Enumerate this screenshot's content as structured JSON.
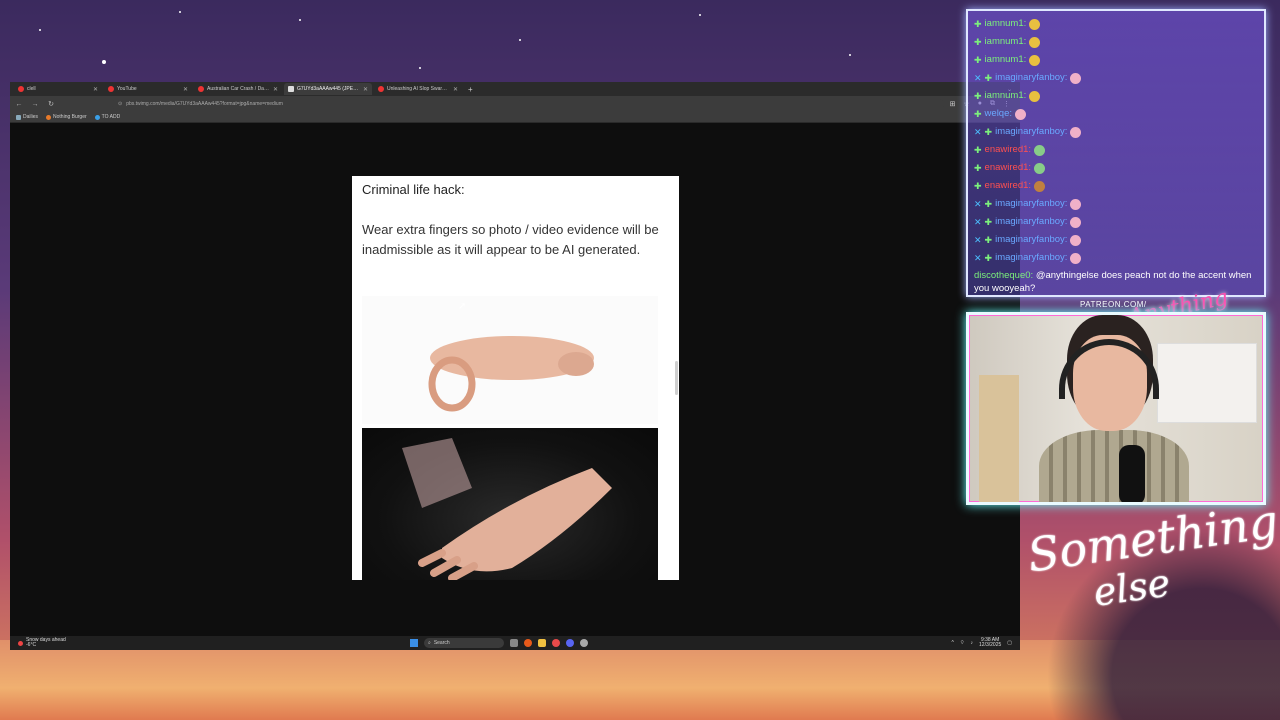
{
  "browser": {
    "tabs": [
      {
        "label": "clell",
        "active": false
      },
      {
        "label": "YouTube",
        "active": false
      },
      {
        "label": "Australian Car Crash / Dash Ca",
        "active": false
      },
      {
        "label": "G7UYd3aAAAw445 (JPEG Image",
        "active": true
      },
      {
        "label": "Unleashing AI Slop Swarms - Y",
        "active": false
      }
    ],
    "new_tab": "+",
    "tab_dropdown": "⌄",
    "url": "pbs.twimg.com/media/G7UYd3aAAAw445?format=jpg&name=medium",
    "bookmarks": [
      {
        "label": "Dailies",
        "icon": "folder-icon"
      },
      {
        "label": "Nothing Burger",
        "icon": "burger-icon"
      },
      {
        "label": "TO ADD",
        "icon": "globe-icon"
      }
    ]
  },
  "image": {
    "title": "Criminal life hack:",
    "body": "Wear extra fingers so photo / video evidence will be inadmissible as it will appear to be AI generated."
  },
  "taskbar": {
    "weather_line1": "Snow days ahead",
    "weather_line2": "-6°C",
    "search_label": "Search",
    "time": "9:38 AM",
    "date": "12/3/2025"
  },
  "chat": {
    "messages": [
      {
        "user": "iamnum1:",
        "color": "#7cf07c",
        "badges": 1,
        "emote": "#e8c040"
      },
      {
        "user": "iamnum1:",
        "color": "#7cf07c",
        "badges": 1,
        "emote": "#e8c040"
      },
      {
        "user": "iamnum1:",
        "color": "#7cf07c",
        "badges": 1,
        "emote": "#e8c040"
      },
      {
        "user": "imaginaryfanboy:",
        "color": "#6aa8ff",
        "badges": 2,
        "emote": "#f0b0c8"
      },
      {
        "user": "iamnum1:",
        "color": "#7cf07c",
        "badges": 1,
        "emote": "#e8c040"
      },
      {
        "user": "welqe:",
        "color": "#6aa8ff",
        "badges": 1,
        "emote": "#f0b0c8"
      },
      {
        "user": "imaginaryfanboy:",
        "color": "#6aa8ff",
        "badges": 2,
        "emote": "#f0b0c8"
      },
      {
        "user": "enawired1:",
        "color": "#ff5050",
        "badges": 1,
        "emote": "#88cc88"
      },
      {
        "user": "enawired1:",
        "color": "#ff5050",
        "badges": 1,
        "emote": "#88cc88"
      },
      {
        "user": "enawired1:",
        "color": "#ff5050",
        "badges": 1,
        "emote": "#c08040"
      },
      {
        "user": "imaginaryfanboy:",
        "color": "#6aa8ff",
        "badges": 2,
        "emote": "#f0b0c8"
      },
      {
        "user": "imaginaryfanboy:",
        "color": "#6aa8ff",
        "badges": 2,
        "emote": "#f0b0c8"
      },
      {
        "user": "imaginaryfanboy:",
        "color": "#6aa8ff",
        "badges": 2,
        "emote": "#f0b0c8"
      },
      {
        "user": "imaginaryfanboy:",
        "color": "#6aa8ff",
        "badges": 2,
        "emote": "#f0b0c8"
      }
    ],
    "last_message": {
      "user": "discotheque0:",
      "user_color": "#7cf07c",
      "text": "@anythingelse does peach not do the accent when you wooyeah?"
    }
  },
  "overlay": {
    "patreon": "PATREON.COM/",
    "logo": "Anything else",
    "title_line1": "Something",
    "title_line2": "else"
  }
}
